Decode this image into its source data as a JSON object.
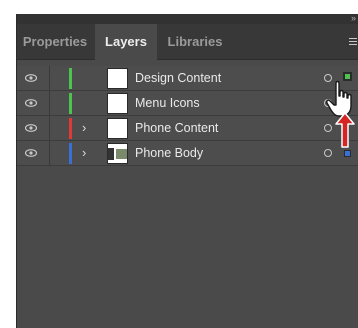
{
  "tabs": [
    {
      "label": "Properties",
      "active": false
    },
    {
      "label": "Layers",
      "active": true
    },
    {
      "label": "Libraries",
      "active": false
    }
  ],
  "layers": [
    {
      "name": "Design Content",
      "color": "#4ec24e",
      "expandable": false,
      "thumbnail": "blank",
      "selected_color": "#4ec24e"
    },
    {
      "name": "Menu Icons",
      "color": "#4ec24e",
      "expandable": false,
      "thumbnail": "blank"
    },
    {
      "name": "Phone Content",
      "color": "#e23838",
      "expandable": true,
      "thumbnail": "blank"
    },
    {
      "name": "Phone Body",
      "color": "#3a6fd8",
      "expandable": true,
      "thumbnail": "phone",
      "selected_color": "#3a6fd8"
    }
  ],
  "icons": {
    "eye": "eye-icon",
    "chevron": "chevron-right-icon",
    "collapse": "double-chevron-icon",
    "panel_menu": "hamburger-menu-icon",
    "cursor": "hand-pointer-icon",
    "arrow": "red-up-arrow-icon"
  },
  "colors": {
    "panel_bg": "#4a4a4a",
    "tabbar_bg": "#383838",
    "arrow": "#d42424"
  }
}
